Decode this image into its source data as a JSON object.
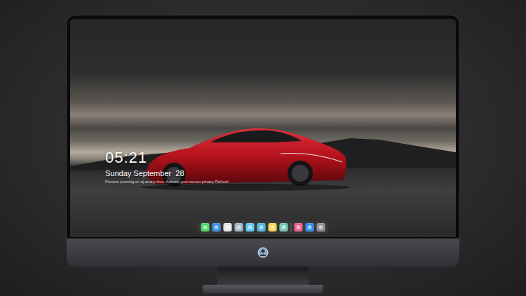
{
  "lock_screen": {
    "time": "05:21",
    "date": "Sunday September  28",
    "notice": "Preview (running on a) at any time. Activate your screen privacy  Refresh"
  },
  "dock": {
    "items": [
      {
        "color": "#4cd964"
      },
      {
        "color": "#3a8ee6"
      },
      {
        "color": "#e6e6e6"
      },
      {
        "color": "#9fb7c9"
      },
      {
        "color": "#5ac8fa"
      },
      {
        "color": "#4fb6e0"
      },
      {
        "color": "#f7d54a"
      },
      {
        "color": "#6ec7b0"
      },
      {
        "color": "#f05a8c"
      },
      {
        "color": "#2f8cf0"
      },
      {
        "color": "#8e8e93"
      }
    ]
  }
}
